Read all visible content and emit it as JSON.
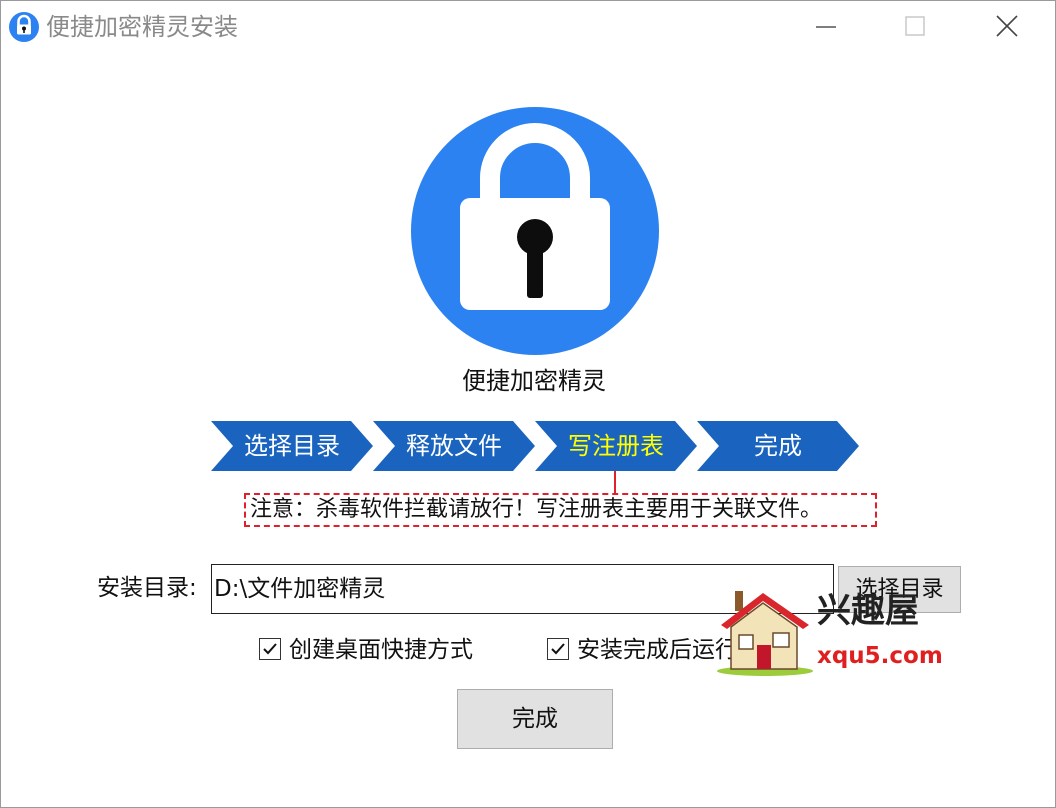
{
  "window": {
    "title": "便捷加密精灵安装"
  },
  "app": {
    "name": "便捷加密精灵",
    "accent": "#2b82f0",
    "step_color": "#1a64c0"
  },
  "steps": [
    {
      "label": "选择目录",
      "active": false
    },
    {
      "label": "释放文件",
      "active": false
    },
    {
      "label": "写注册表",
      "active": true
    },
    {
      "label": "完成",
      "active": false
    }
  ],
  "notice": "注意：杀毒软件拦截请放行！写注册表主要用于关联文件。",
  "install": {
    "dir_label": "安装目录:",
    "dir_value": "D:\\文件加密精灵",
    "browse_label": "选择目录"
  },
  "options": [
    {
      "label": "创建桌面快捷方式",
      "checked": true
    },
    {
      "label": "安装完成后运行",
      "checked": true
    }
  ],
  "finish_label": "完成",
  "watermark": {
    "name": "兴趣屋",
    "url": "xqu5.com"
  }
}
